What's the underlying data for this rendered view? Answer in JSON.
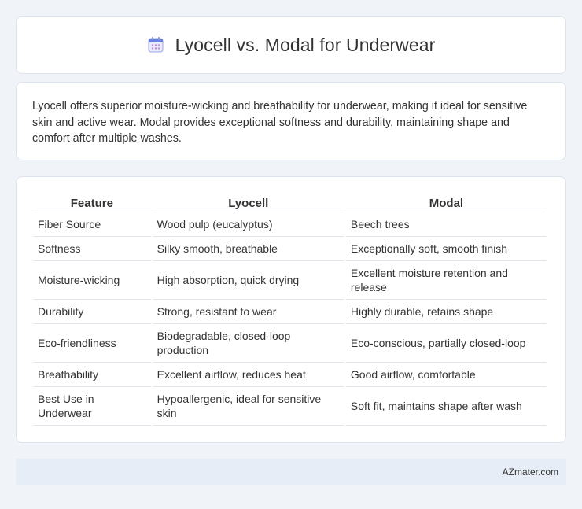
{
  "header": {
    "title": "Lyocell vs. Modal for Underwear",
    "icon": "calendar-icon",
    "icon_color": "#6b7fe0"
  },
  "intro": {
    "text": "Lyocell offers superior moisture-wicking and breathability for underwear, making it ideal for sensitive skin and active wear. Modal provides exceptional softness and durability, maintaining shape and comfort after multiple washes."
  },
  "table": {
    "headers": [
      "Feature",
      "Lyocell",
      "Modal"
    ],
    "rows": [
      [
        "Fiber Source",
        "Wood pulp (eucalyptus)",
        "Beech trees"
      ],
      [
        "Softness",
        "Silky smooth, breathable",
        "Exceptionally soft, smooth finish"
      ],
      [
        "Moisture-wicking",
        "High absorption, quick drying",
        "Excellent moisture retention and release"
      ],
      [
        "Durability",
        "Strong, resistant to wear",
        "Highly durable, retains shape"
      ],
      [
        "Eco-friendliness",
        "Biodegradable, closed-loop production",
        "Eco-conscious, partially closed-loop"
      ],
      [
        "Breathability",
        "Excellent airflow, reduces heat",
        "Good airflow, comfortable"
      ],
      [
        "Best Use in Underwear",
        "Hypoallergenic, ideal for sensitive skin",
        "Soft fit, maintains shape after wash"
      ]
    ]
  },
  "footer": {
    "text": "AZmater.com"
  }
}
